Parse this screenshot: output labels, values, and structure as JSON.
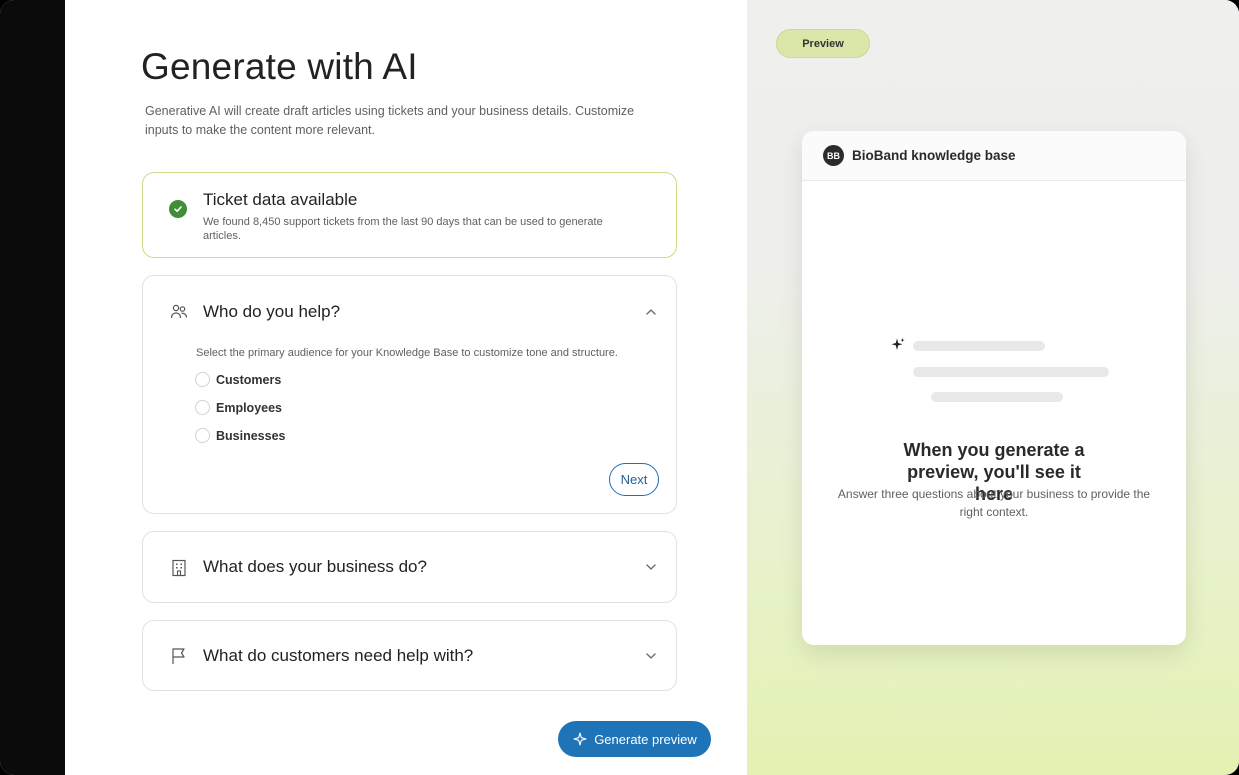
{
  "page": {
    "title": "Generate with AI",
    "subtitle": "Generative AI will create draft articles using tickets and your business details. Customize inputs to make the content more relevant."
  },
  "ticket_card": {
    "title": "Ticket data available",
    "description": "We found 8,450 support tickets from the last 90 days that can be used to generate articles.",
    "icon": "check-circle-icon"
  },
  "who_section": {
    "title": "Who do you help?",
    "icon": "people-icon",
    "helper": "Select the primary audience for your Knowledge Base to customize tone and structure.",
    "options": [
      "Customers",
      "Employees",
      "Businesses"
    ],
    "next_label": "Next",
    "expanded": true
  },
  "business_section": {
    "title": "What does your business do?",
    "icon": "building-icon",
    "expanded": false
  },
  "help_section": {
    "title": "What do customers need help with?",
    "icon": "flag-icon",
    "expanded": false
  },
  "generate_button": {
    "label": "Generate preview",
    "icon": "sparkle-icon"
  },
  "preview_panel": {
    "pill": "Preview",
    "kb_avatar": "BB",
    "kb_title": "BioBand knowledge base",
    "heading": "When you generate a preview, you'll see it here",
    "subtext": "Answer three questions about your business to provide the right context."
  },
  "colors": {
    "accent": "#1f73b7",
    "success": "#3f8f3a",
    "pill_bg": "#dae7a9"
  }
}
